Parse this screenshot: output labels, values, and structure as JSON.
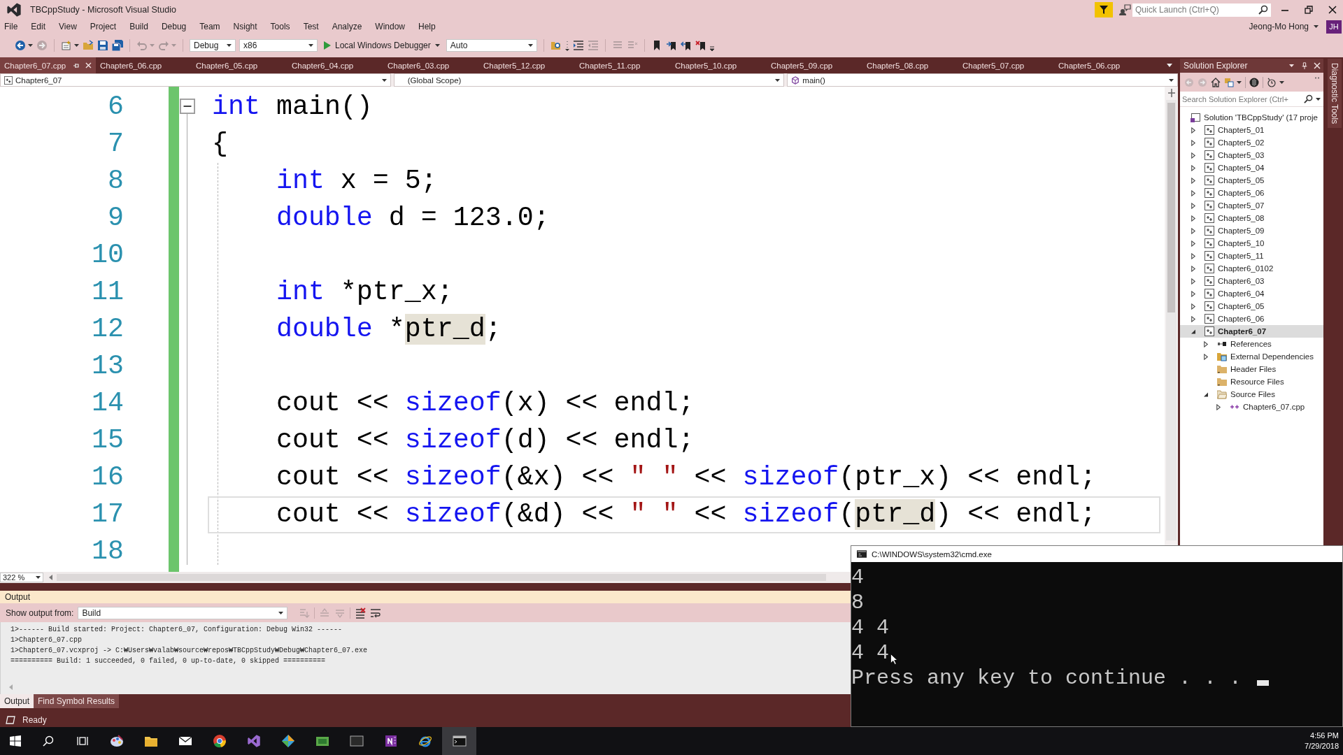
{
  "window": {
    "title": "TBCppStudy - Microsoft Visual Studio",
    "quick_launch": {
      "placeholder": "Quick Launch (Ctrl+Q)"
    },
    "user": {
      "name": "Jeong-Mo Hong",
      "initials": "JH"
    }
  },
  "menu": [
    "File",
    "Edit",
    "View",
    "Project",
    "Build",
    "Debug",
    "Team",
    "Nsight",
    "Tools",
    "Test",
    "Analyze",
    "Window",
    "Help"
  ],
  "toolbar": {
    "configuration": "Debug",
    "platform": "x86",
    "debugger": "Local Windows Debugger",
    "mode": "Auto"
  },
  "tabs": [
    {
      "label": "Chapter6_07.cpp",
      "selected": true
    },
    {
      "label": "Chapter6_06.cpp",
      "selected": false
    },
    {
      "label": "Chapter6_05.cpp",
      "selected": false
    },
    {
      "label": "Chapter6_04.cpp",
      "selected": false
    },
    {
      "label": "Chapter6_03.cpp",
      "selected": false
    },
    {
      "label": "Chapter5_12.cpp",
      "selected": false
    },
    {
      "label": "Chapter5_11.cpp",
      "selected": false
    },
    {
      "label": "Chapter5_10.cpp",
      "selected": false
    },
    {
      "label": "Chapter5_09.cpp",
      "selected": false
    },
    {
      "label": "Chapter5_08.cpp",
      "selected": false
    },
    {
      "label": "Chapter5_07.cpp",
      "selected": false
    },
    {
      "label": "Chapter5_06.cpp",
      "selected": false
    }
  ],
  "navigation": {
    "project": "Chapter6_07",
    "scope": "(Global Scope)",
    "member": "main()"
  },
  "editor": {
    "zoom": "322 %",
    "lines": [
      {
        "number": "6",
        "current": false,
        "tokens": [
          {
            "text": "int",
            "kind": "keyword"
          },
          {
            "text": " main()",
            "kind": "plain"
          }
        ]
      },
      {
        "number": "7",
        "current": false,
        "tokens": [
          {
            "text": "{",
            "kind": "plain"
          }
        ]
      },
      {
        "number": "8",
        "current": false,
        "tokens": [
          {
            "text": "    int",
            "kind": "keyword"
          },
          {
            "text": " x = 5;",
            "kind": "plain"
          }
        ]
      },
      {
        "number": "9",
        "current": false,
        "tokens": [
          {
            "text": "    double",
            "kind": "keyword"
          },
          {
            "text": " d = 123.0;",
            "kind": "plain"
          }
        ]
      },
      {
        "number": "10",
        "current": false
      },
      {
        "number": "11",
        "current": false,
        "tokens": [
          {
            "text": "    int",
            "kind": "keyword"
          },
          {
            "text": " *ptr_x;",
            "kind": "plain"
          }
        ]
      },
      {
        "number": "12",
        "current": false,
        "tokens": [
          {
            "text": "    double",
            "kind": "keyword"
          },
          {
            "text": " *",
            "kind": "plain"
          },
          {
            "text": "ptr_d",
            "kind": "reference"
          },
          {
            "text": ";",
            "kind": "plain"
          }
        ]
      },
      {
        "number": "13",
        "current": false
      },
      {
        "number": "14",
        "current": false,
        "tokens": [
          {
            "text": "    cout << ",
            "kind": "plain"
          },
          {
            "text": "sizeof",
            "kind": "keyword"
          },
          {
            "text": "(x) << endl;",
            "kind": "plain"
          }
        ]
      },
      {
        "number": "15",
        "current": false,
        "tokens": [
          {
            "text": "    cout << ",
            "kind": "plain"
          },
          {
            "text": "sizeof",
            "kind": "keyword"
          },
          {
            "text": "(d) << endl;",
            "kind": "plain"
          }
        ]
      },
      {
        "number": "16",
        "current": false,
        "tokens": [
          {
            "text": "    cout << ",
            "kind": "plain"
          },
          {
            "text": "sizeof",
            "kind": "keyword"
          },
          {
            "text": "(&x) << ",
            "kind": "plain"
          },
          {
            "text": "\" \"",
            "kind": "string"
          },
          {
            "text": " << ",
            "kind": "plain"
          },
          {
            "text": "sizeof",
            "kind": "keyword"
          },
          {
            "text": "(ptr_x) << endl;",
            "kind": "plain"
          }
        ]
      },
      {
        "number": "17",
        "current": true,
        "tokens": [
          {
            "text": "    cout << ",
            "kind": "plain"
          },
          {
            "text": "sizeof",
            "kind": "keyword"
          },
          {
            "text": "(&d) << ",
            "kind": "plain"
          },
          {
            "text": "\" \"",
            "kind": "string"
          },
          {
            "text": " << ",
            "kind": "plain"
          },
          {
            "text": "sizeof",
            "kind": "keyword"
          },
          {
            "text": "(",
            "kind": "plain"
          },
          {
            "text": "ptr_d",
            "kind": "reference"
          },
          {
            "text": ") << endl;",
            "kind": "plain"
          }
        ]
      },
      {
        "number": "18",
        "current": false
      }
    ]
  },
  "output": {
    "title": "Output",
    "source_label": "Show output from:",
    "source": "Build",
    "lines": [
      "1>------ Build started: Project: Chapter6_07, Configuration: Debug Win32 ------",
      "1>Chapter6_07.cpp",
      "1>Chapter6_07.vcxproj -> C:₩Users₩valab₩source₩repos₩TBCppStudy₩Debug₩Chapter6_07.exe",
      "========== Build: 1 succeeded, 0 failed, 0 up-to-date, 0 skipped =========="
    ],
    "tabs": [
      {
        "label": "Output",
        "selected": true
      },
      {
        "label": "Find Symbol Results",
        "selected": false
      }
    ]
  },
  "solution_explorer": {
    "title": "Solution Explorer",
    "search": {
      "placeholder": "Search Solution Explorer (Ctrl+"
    },
    "side_tab": "Diagnostic Tools",
    "tree": [
      {
        "label": "Solution 'TBCppStudy' (17 proje",
        "kind": "solution",
        "selected": false,
        "children": [
          {
            "label": "Chapter5_01",
            "kind": "project",
            "expanded": false,
            "selected": false
          },
          {
            "label": "Chapter5_02",
            "kind": "project",
            "expanded": false,
            "selected": false
          },
          {
            "label": "Chapter5_03",
            "kind": "project",
            "expanded": false,
            "selected": false
          },
          {
            "label": "Chapter5_04",
            "kind": "project",
            "expanded": false,
            "selected": false
          },
          {
            "label": "Chapter5_05",
            "kind": "project",
            "expanded": false,
            "selected": false
          },
          {
            "label": "Chapter5_06",
            "kind": "project",
            "expanded": false,
            "selected": false
          },
          {
            "label": "Chapter5_07",
            "kind": "project",
            "expanded": false,
            "selected": false
          },
          {
            "label": "Chapter5_08",
            "kind": "project",
            "expanded": false,
            "selected": false
          },
          {
            "label": "Chapter5_09",
            "kind": "project",
            "expanded": false,
            "selected": false
          },
          {
            "label": "Chapter5_10",
            "kind": "project",
            "expanded": false,
            "selected": false
          },
          {
            "label": "Chapter5_11",
            "kind": "project",
            "expanded": false,
            "selected": false
          },
          {
            "label": "Chapter6_0102",
            "kind": "project",
            "expanded": false,
            "selected": false
          },
          {
            "label": "Chapter6_03",
            "kind": "project",
            "expanded": false,
            "selected": false
          },
          {
            "label": "Chapter6_04",
            "kind": "project",
            "expanded": false,
            "selected": false
          },
          {
            "label": "Chapter6_05",
            "kind": "project",
            "expanded": false,
            "selected": false
          },
          {
            "label": "Chapter6_06",
            "kind": "project",
            "expanded": false,
            "selected": false
          },
          {
            "label": "Chapter6_07",
            "kind": "project",
            "expanded": true,
            "selected": true,
            "children": [
              {
                "label": "References",
                "kind": "references",
                "expanded": false,
                "selected": false
              },
              {
                "label": "External Dependencies",
                "kind": "dependencies",
                "expanded": false,
                "selected": false
              },
              {
                "label": "Header Files",
                "kind": "folder",
                "selected": false
              },
              {
                "label": "Resource Files",
                "kind": "folder",
                "selected": false
              },
              {
                "label": "Source Files",
                "kind": "folder",
                "expanded": true,
                "selected": false,
                "children": [
                  {
                    "label": "Chapter6_07.cpp",
                    "kind": "cpp-file",
                    "expanded": false,
                    "selected": false
                  }
                ]
              }
            ]
          }
        ]
      }
    ]
  },
  "status_bar": {
    "text": "Ready"
  },
  "console": {
    "title": "C:\\WINDOWS\\system32\\cmd.exe",
    "lines": [
      "4",
      "8",
      "4 4",
      "4 4",
      "Press any key to continue . . ."
    ]
  },
  "taskbar": {
    "apps": [
      {
        "kind": "start",
        "selected": false
      },
      {
        "kind": "search",
        "selected": false
      },
      {
        "kind": "taskview",
        "selected": false
      },
      {
        "kind": "paint",
        "selected": false
      },
      {
        "kind": "files",
        "selected": false
      },
      {
        "kind": "mail",
        "selected": false
      },
      {
        "kind": "browser",
        "selected": false
      },
      {
        "kind": "studio",
        "selected": false
      },
      {
        "kind": "git",
        "selected": false
      },
      {
        "kind": "board",
        "selected": false
      },
      {
        "kind": "screen",
        "selected": false
      },
      {
        "kind": "notes",
        "selected": false
      },
      {
        "kind": "web",
        "selected": false
      },
      {
        "kind": "console",
        "selected": true
      }
    ],
    "time": "4:56 PM",
    "date": "7/29/2018"
  }
}
